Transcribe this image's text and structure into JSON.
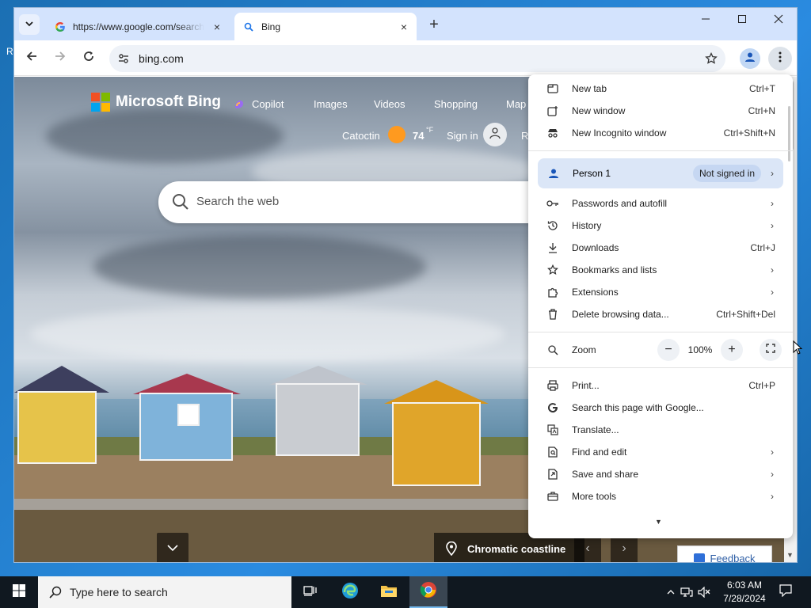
{
  "desktop": {
    "fragment_letter": "R"
  },
  "tabs": [
    {
      "title": "https://www.google.com/search",
      "favicon": "google-icon",
      "close": "×"
    },
    {
      "title": "Bing",
      "favicon": "search-icon",
      "close": "×"
    }
  ],
  "tabstrip": {
    "new_tab": "+"
  },
  "toolbar": {
    "url": "bing.com"
  },
  "bing": {
    "logo_text": "Microsoft Bing",
    "nav": [
      "Copilot",
      "Images",
      "Videos",
      "Shopping",
      "Map"
    ],
    "location": "Catoctin",
    "temperature": "74",
    "temp_unit": "°F",
    "sign_in": "Sign in",
    "sign_in_fragment": "R",
    "search_placeholder": "Search the web",
    "image_caption": "Chromatic coastline",
    "feedback": "Feedback"
  },
  "menu": {
    "new_tab": {
      "label": "New tab",
      "shortcut": "Ctrl+T"
    },
    "new_window": {
      "label": "New window",
      "shortcut": "Ctrl+N"
    },
    "new_incognito": {
      "label": "New Incognito window",
      "shortcut": "Ctrl+Shift+N"
    },
    "person": {
      "label": "Person 1",
      "status": "Not signed in"
    },
    "passwords": {
      "label": "Passwords and autofill"
    },
    "history": {
      "label": "History"
    },
    "downloads": {
      "label": "Downloads",
      "shortcut": "Ctrl+J"
    },
    "bookmarks": {
      "label": "Bookmarks and lists"
    },
    "extensions": {
      "label": "Extensions"
    },
    "delete_data": {
      "label": "Delete browsing data...",
      "shortcut": "Ctrl+Shift+Del"
    },
    "zoom": {
      "label": "Zoom",
      "value": "100%",
      "minus": "−",
      "plus": "+"
    },
    "print": {
      "label": "Print...",
      "shortcut": "Ctrl+P"
    },
    "search_google": {
      "label": "Search this page with Google..."
    },
    "translate": {
      "label": "Translate..."
    },
    "find_edit": {
      "label": "Find and edit"
    },
    "save_share": {
      "label": "Save and share"
    },
    "more_tools": {
      "label": "More tools"
    }
  },
  "taskbar": {
    "search_placeholder": "Type here to search",
    "time": "6:03 AM",
    "date": "7/28/2024"
  },
  "colors": {
    "tabstrip_bg": "#d3e3fd",
    "menu_highlight": "#dbe6f7",
    "taskbar_bg": "#101820",
    "ms_red": "#f25022",
    "ms_green": "#7fba00",
    "ms_blue": "#00a4ef",
    "ms_yellow": "#ffb900"
  }
}
